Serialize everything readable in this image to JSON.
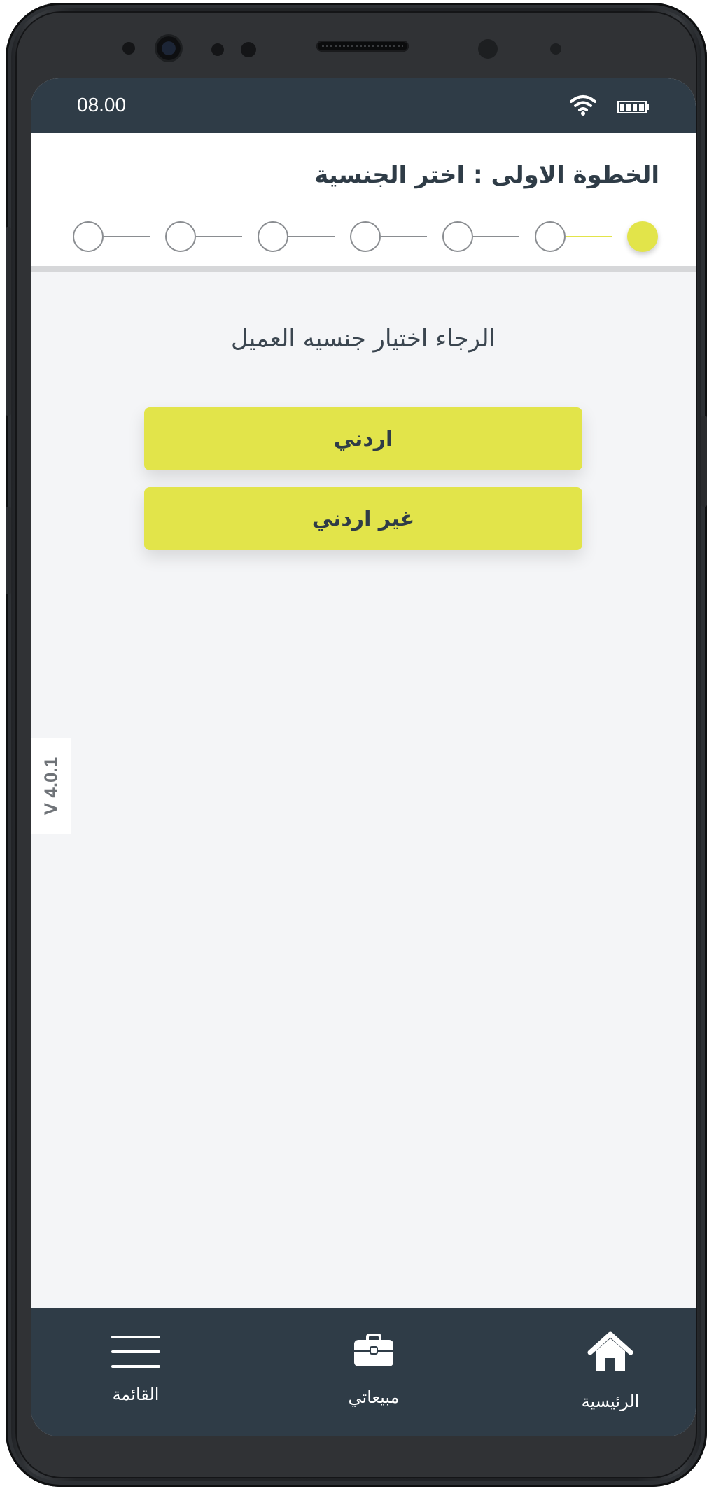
{
  "status_bar": {
    "time": "08.00",
    "icons": [
      "wifi-icon",
      "battery-icon"
    ]
  },
  "step_header": {
    "title": "الخطوة الاولى : اختر الجنسية",
    "total_steps": 7,
    "current_step": 1
  },
  "main": {
    "prompt": "الرجاء اختيار جنسيه العميل",
    "options": [
      {
        "label": "اردني"
      },
      {
        "label": "غير اردني"
      }
    ]
  },
  "version": "V 4.0.1",
  "bottom_nav": {
    "items": [
      {
        "label": "القائمة",
        "icon": "hamburger-menu-icon"
      },
      {
        "label": "مبيعاتي",
        "icon": "briefcase-icon"
      },
      {
        "label": "الرئيسية",
        "icon": "home-icon"
      }
    ]
  },
  "colors": {
    "accent": "#e2e44a",
    "dark": "#2f3c47",
    "background": "#f4f5f7"
  }
}
